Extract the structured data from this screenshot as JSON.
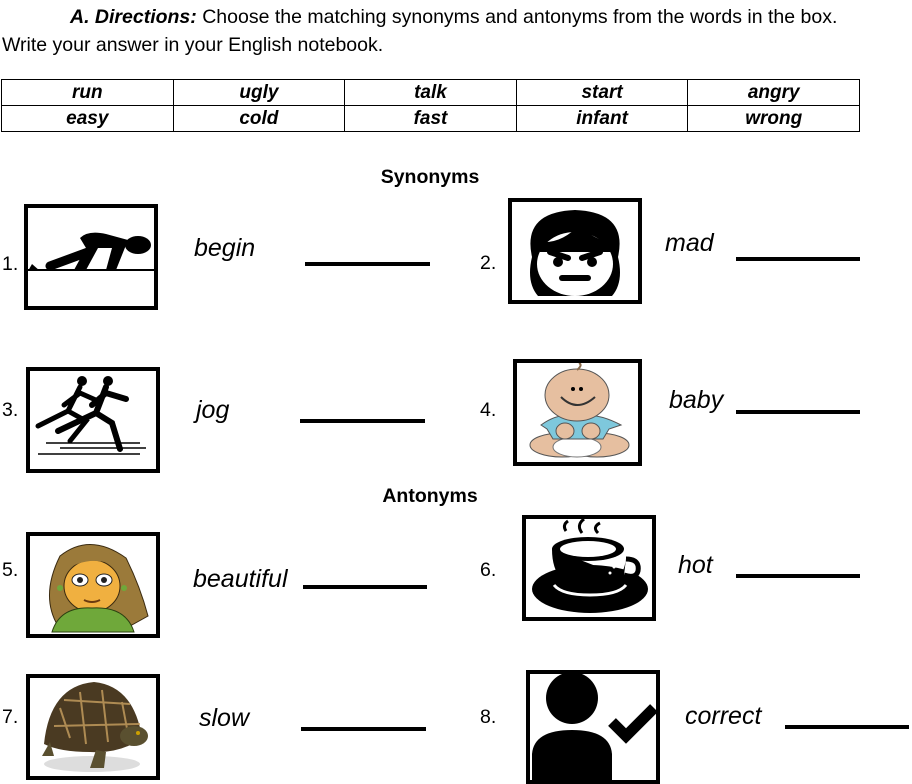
{
  "directions": {
    "label": "A. Directions:",
    "text": " Choose the matching synonyms and antonyms from the words in the box. Write your answer in your English notebook."
  },
  "word_box": {
    "rows": [
      [
        "run",
        "ugly",
        "talk",
        "start",
        "angry"
      ],
      [
        "easy",
        "cold",
        "fast",
        "infant",
        "wrong"
      ]
    ]
  },
  "sections": {
    "synonyms": "Synonyms",
    "antonyms": "Antonyms"
  },
  "items": [
    {
      "number": "1.",
      "word": "begin",
      "image": "sprinter-start-icon"
    },
    {
      "number": "2.",
      "word": "mad",
      "image": "angry-face-icon"
    },
    {
      "number": "3.",
      "word": "jog",
      "image": "runners-icon"
    },
    {
      "number": "4.",
      "word": "baby",
      "image": "baby-icon"
    },
    {
      "number": "5.",
      "word": "beautiful",
      "image": "girl-face-icon"
    },
    {
      "number": "6.",
      "word": "hot",
      "image": "hot-cup-icon"
    },
    {
      "number": "7.",
      "word": "slow",
      "image": "turtle-icon"
    },
    {
      "number": "8.",
      "word": "correct",
      "image": "person-check-icon"
    }
  ]
}
